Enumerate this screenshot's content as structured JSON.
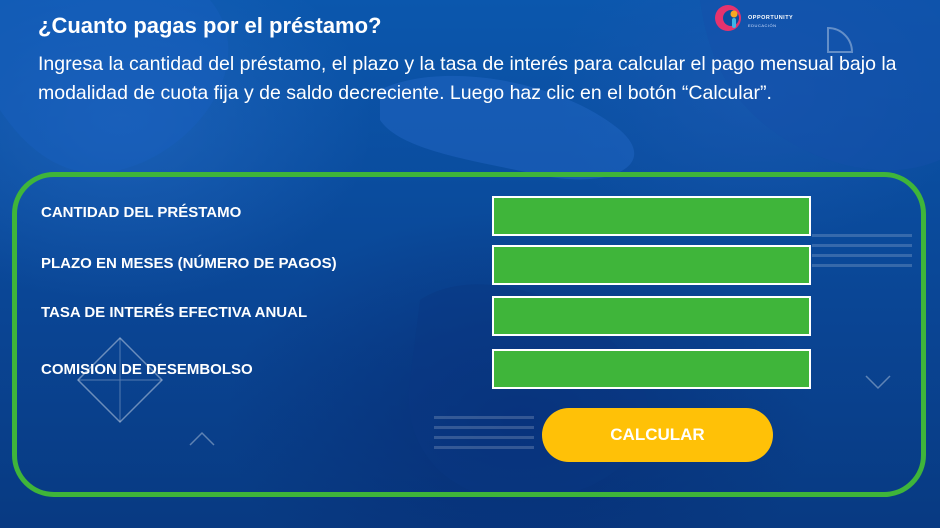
{
  "header": {
    "title": "¿Cuanto pagas por el préstamo?",
    "subtitle": "Ingresa la cantidad del préstamo, el plazo y la tasa de interés para calcular el pago mensual bajo la modalidad de cuota fija y de saldo decreciente.  Luego haz clic en el botón “Calcular”."
  },
  "logo": {
    "name": "OPPORTUNITY",
    "sub": "EDUCACIÓN"
  },
  "form": {
    "fields": [
      {
        "label": "CANTIDAD DEL PRÉSTAMO",
        "value": "",
        "placeholder": ""
      },
      {
        "label": "PLAZO EN MESES (NÚMERO DE PAGOS)",
        "value": "",
        "placeholder": ""
      },
      {
        "label": "TASA DE INTERÉS EFECTIVA ANUAL",
        "value": "",
        "placeholder": ""
      },
      {
        "label": "COMISION DE DESEMBOLSO",
        "value": "",
        "placeholder": ""
      }
    ],
    "submit_label": "CALCULAR"
  },
  "colors": {
    "background": "#0a4da0",
    "accent_green": "#3fb53a",
    "button_yellow": "#ffc107",
    "text": "#ffffff"
  }
}
